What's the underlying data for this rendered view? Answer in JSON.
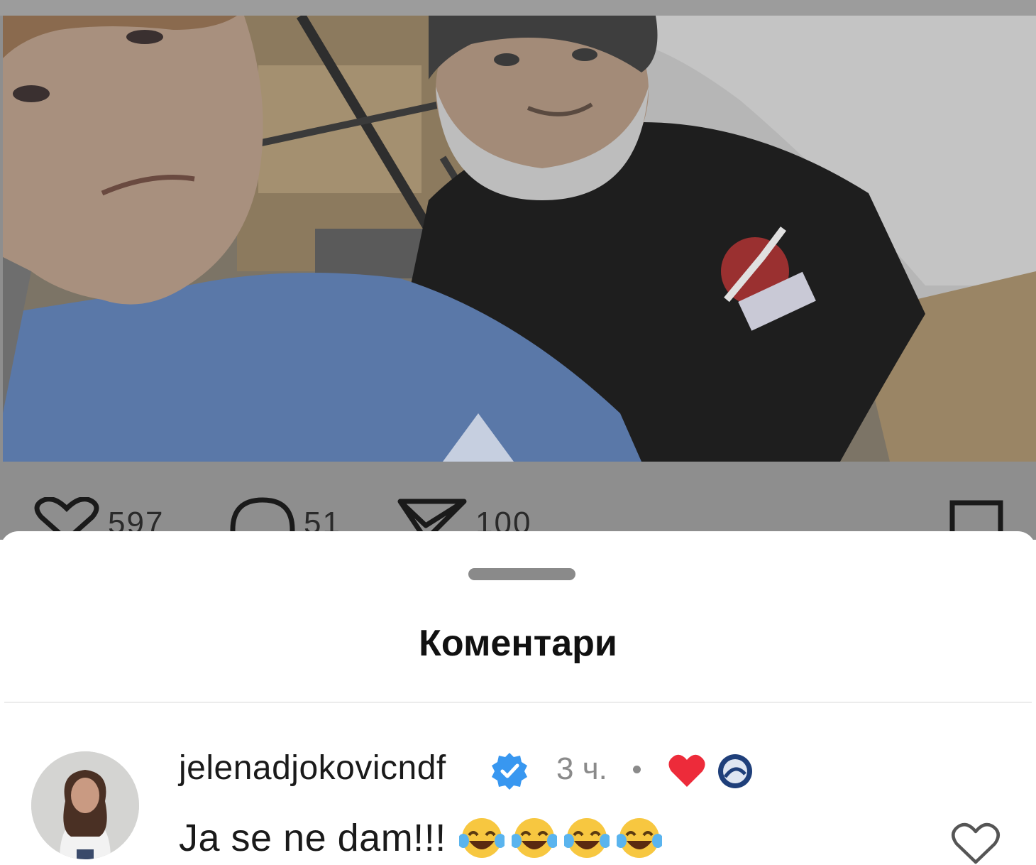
{
  "post": {
    "photo_alt": "post-photo",
    "likes_count": "597",
    "comments_count": "51",
    "shares_count": "100"
  },
  "sheet": {
    "title": "Коментари"
  },
  "comment": {
    "username": "jelenadjokovicndf",
    "time": "3 ч.",
    "text": "Ja se ne dam!!!",
    "emojis": [
      "face-with-tears-of-joy",
      "face-with-tears-of-joy",
      "face-with-tears-of-joy",
      "face-with-tears-of-joy"
    ]
  },
  "icons": {
    "like": "heart-outline-icon",
    "comment": "speech-bubble-icon",
    "share": "paper-plane-icon",
    "bookmark": "bookmark-icon",
    "verified": "verified-badge-icon",
    "creator_like": "red-heart-icon"
  },
  "colors": {
    "verified": "#3897f0",
    "creator_heart": "#ed2b3a",
    "dim_overlay": "#8e8e8e"
  }
}
